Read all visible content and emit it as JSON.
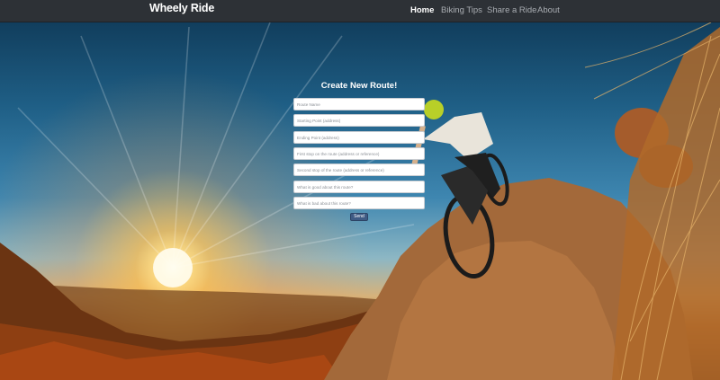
{
  "brand": "Wheely Ride",
  "nav": [
    {
      "label": "Home",
      "active": true
    },
    {
      "label": "Biking Tips",
      "active": false
    },
    {
      "label": "Share a Ride",
      "active": false
    },
    {
      "label": "About",
      "active": false
    }
  ],
  "form": {
    "title": "Create New Route!",
    "fields": [
      {
        "placeholder": "Route Name"
      },
      {
        "placeholder": "Starting Point (address)"
      },
      {
        "placeholder": "Ending Point (address)"
      },
      {
        "placeholder": "First stop on the route (address or reference)"
      },
      {
        "placeholder": "Second stop of the route (address or reference)"
      },
      {
        "placeholder": "What is good about this route?"
      },
      {
        "placeholder": "What is bad about this route?"
      }
    ],
    "submit_label": "Send"
  },
  "colors": {
    "navbar": "#2d3136",
    "brand_text": "#ffffff",
    "submit_button": "#3f5b84"
  }
}
